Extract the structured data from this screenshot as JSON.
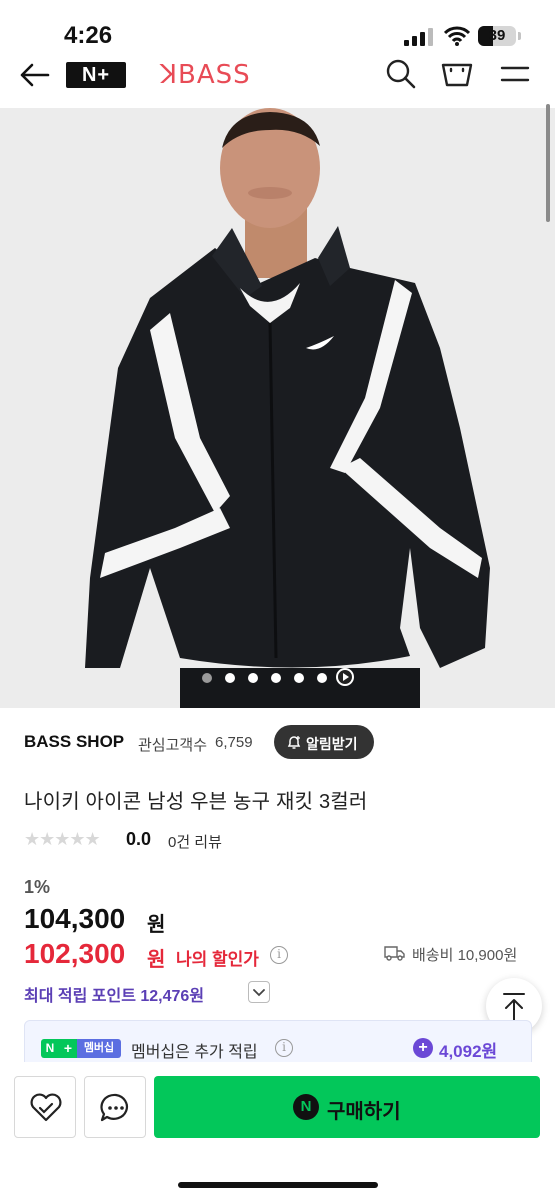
{
  "status_bar": {
    "time": "4:26",
    "battery": "39"
  },
  "header": {
    "logo_text": "N+",
    "brand": "ꓘBASS"
  },
  "product_image": {
    "slide_count": 7,
    "active_slide": 2
  },
  "store": {
    "name": "BASS SHOP",
    "fav_label": "관심고객수",
    "fav_count": "6,759",
    "alert_button": "알림받기"
  },
  "product": {
    "title": "나이키 아이콘 남성 우븐 농구 재킷 3컬러",
    "stars": "★★★★★",
    "rating": "0.0",
    "reviews": "0건 리뷰"
  },
  "pricing": {
    "discount": "1%",
    "price": "104,300",
    "price_unit": "원",
    "sale_price": "102,300",
    "sale_unit": "원",
    "my_discount_label": "나의 할인가",
    "info_glyph": "i",
    "shipping": "배송비 10,900원"
  },
  "points": {
    "label": "최대 적립 포인트 12,476원"
  },
  "membership": {
    "badge_n": "N",
    "badge_plus": "+",
    "badge_label": "멤버십",
    "text": "멤버십은 추가 적립",
    "plus_glyph": "+",
    "points": "4,092원"
  },
  "bottom_bar": {
    "buy_icon": "N",
    "buy_label": "구매하기"
  },
  "colors": {
    "brand_red": "#e84b56",
    "sale_red": "#e5283a",
    "naver_green": "#03c75a",
    "points_purple": "#5b3fb5"
  }
}
